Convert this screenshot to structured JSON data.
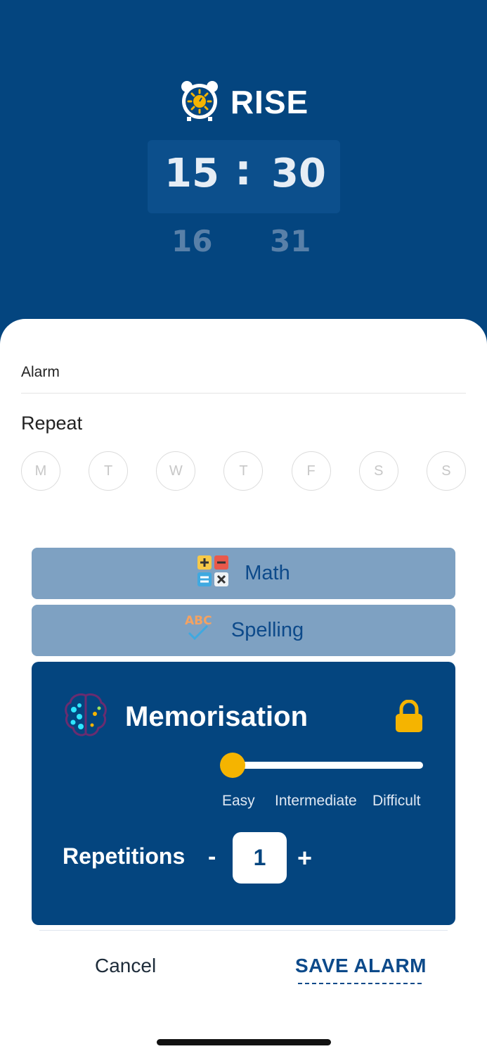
{
  "app": {
    "brand": "RISE"
  },
  "time_picker": {
    "hour": "15",
    "minute": "30",
    "next_hour": "16",
    "next_minute": "31",
    "separator": ":"
  },
  "alarm": {
    "label": "Alarm"
  },
  "repeat": {
    "title": "Repeat",
    "days": [
      "M",
      "T",
      "W",
      "T",
      "F",
      "S",
      "S"
    ]
  },
  "games": {
    "math": {
      "label": "Math",
      "icon": "calculator-icon"
    },
    "spelling": {
      "label": "Spelling",
      "icon": "abc-check-icon",
      "icon_text": "ABC"
    },
    "memorisation": {
      "label": "Memorisation",
      "icon": "brain-icon",
      "locked_icon": "lock-icon",
      "difficulty_levels": [
        "Easy",
        "Intermediate",
        "Difficult"
      ],
      "difficulty_selected": "Easy",
      "repetitions_label": "Repetitions",
      "repetitions_value": "1",
      "minus": "-",
      "plus": "+"
    }
  },
  "actions": {
    "cancel": "Cancel",
    "save": "SAVE ALARM"
  },
  "colors": {
    "primary": "#04457f",
    "secondary_button": "#7ea1c2",
    "accent": "#f5b400"
  }
}
